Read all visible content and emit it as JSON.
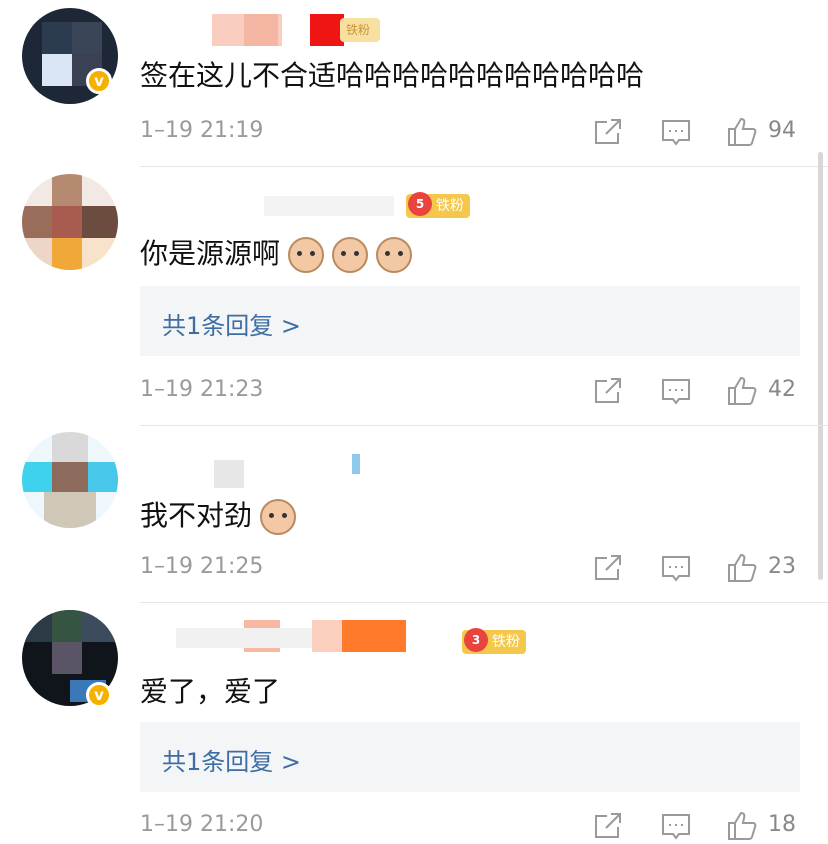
{
  "comments": [
    {
      "text": "签在这儿不合适哈哈哈哈哈哈哈哈哈哈哈",
      "time": "1–19 21:19",
      "likes": "94",
      "verified": true,
      "fan_badge": "铁粉"
    },
    {
      "text": "你是源源啊",
      "emojis": 3,
      "reply_link": "共1条回复 >",
      "time": "1–19 21:23",
      "likes": "42",
      "fan_badge": "铁粉",
      "fan_level": "5"
    },
    {
      "text": "我不对劲",
      "emojis": 1,
      "time": "1–19 21:25",
      "likes": "23"
    },
    {
      "text": "爱了，爱了",
      "reply_link": "共1条回复 >",
      "time": "1–19 21:20",
      "likes": "18",
      "verified": true,
      "fan_badge": "铁粉",
      "fan_level": "3"
    }
  ],
  "icons": {
    "share": "share-icon",
    "comment": "comment-icon",
    "like": "thumbs-up-icon"
  },
  "colors": {
    "link": "#3d6da3",
    "meta": "#9a9a9a",
    "badge": "#f5c84b",
    "verified": "#f6b100"
  }
}
